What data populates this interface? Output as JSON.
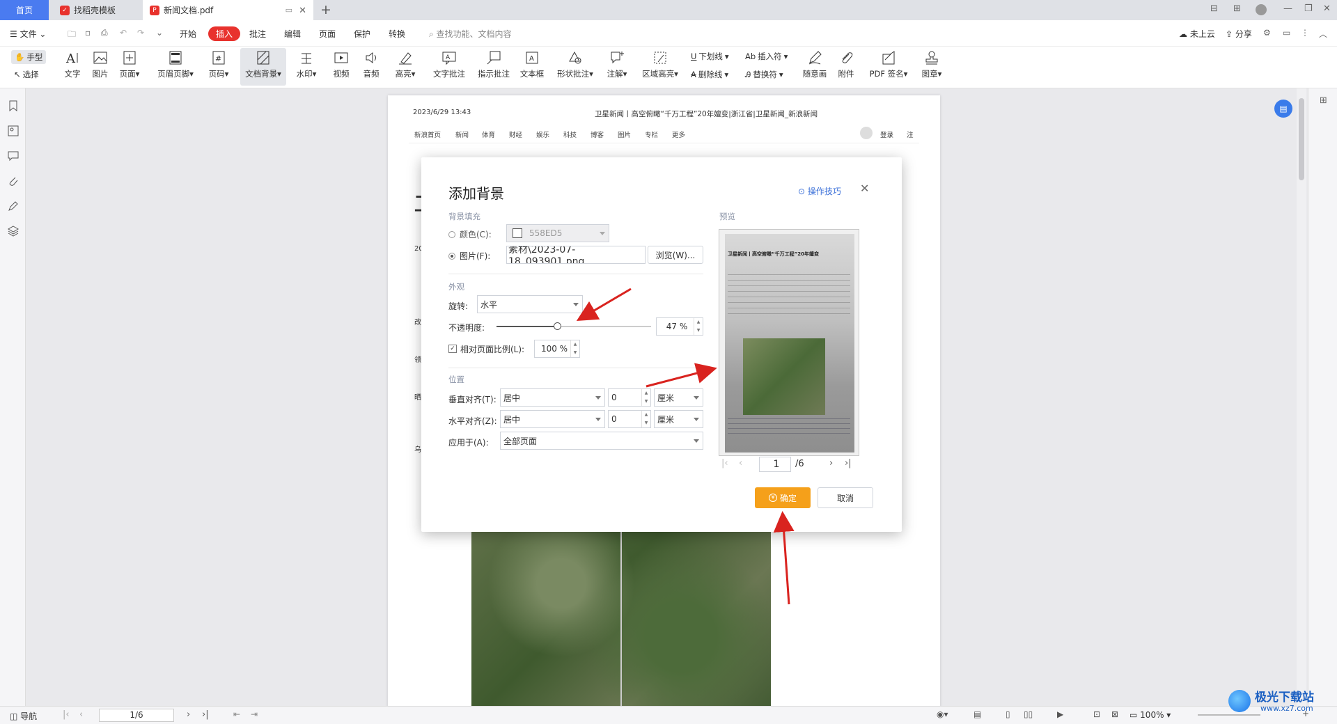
{
  "tabs": {
    "home": "首页",
    "tab1": "找稻壳模板",
    "tab2": "新闻文档.pdf"
  },
  "menu": {
    "file": "文件",
    "items": [
      "开始",
      "插入",
      "批注",
      "编辑",
      "页面",
      "保护",
      "转换"
    ],
    "active": "插入",
    "search": "查找功能、文档内容",
    "right": [
      "未上云",
      "分享"
    ]
  },
  "toolbar": {
    "hand": "手型",
    "select": "选择",
    "buttons": [
      "文字",
      "图片",
      "页面",
      "页眉页脚",
      "页码",
      "文档背景",
      "水印",
      "视频",
      "音频",
      "高亮",
      "文字批注",
      "指示批注",
      "文本框",
      "形状批注",
      "注解",
      "区域高亮"
    ],
    "underline": "下划线",
    "strikethrough": "删除线",
    "insert_symbol": "插入符",
    "replace_symbol": "替换符",
    "more": [
      "随意画",
      "附件",
      "PDF 签名",
      "图章"
    ]
  },
  "page": {
    "datetime": "2023/6/29 13:43",
    "header_title": "卫星新闻丨高空俯瞰“千万工程”20年嬗变|浙江省|卫星新闻_新浪新闻",
    "nav": [
      "新浪首页",
      "新闻",
      "体育",
      "财经",
      "娱乐",
      "科技",
      "博客",
      "图片",
      "专栏",
      "更多"
    ],
    "login": "登录",
    "register": "注",
    "left_fragments": [
      "卫",
      "20",
      "改",
      "领",
      "晒",
      "乌"
    ]
  },
  "dialog": {
    "title": "添加背景",
    "tips": "操作技巧",
    "section_fill": "背景填充",
    "color_label": "颜色(C):",
    "color_value": "558ED5",
    "image_label": "图片(F):",
    "image_path": "素材\\2023-07-18_093901.png",
    "browse": "浏览(W)...",
    "section_look": "外观",
    "rotate_label": "旋转:",
    "rotate_value": "水平",
    "opacity_label": "不透明度:",
    "opacity_value": "47 %",
    "opacity_fraction": 0.47,
    "scale_label": "相对页面比例(L):",
    "scale_value": "100 %",
    "section_position": "位置",
    "valign_label": "垂直对齐(T):",
    "valign_value": "居中",
    "valign_offset": "0",
    "valign_unit": "厘米",
    "halign_label": "水平对齐(Z):",
    "halign_value": "居中",
    "halign_offset": "0",
    "halign_unit": "厘米",
    "apply_label": "应用于(A):",
    "apply_value": "全部页面",
    "preview_label": "预览",
    "preview_page": "1",
    "preview_total": "/6",
    "preview_title": "卫星新闻丨高空俯瞰“千万工程”20年嬗变",
    "ok": "确定",
    "cancel": "取消"
  },
  "status": {
    "nav": "导航",
    "page": "1/6",
    "zoom": "100%"
  },
  "watermark": {
    "site": "极光下载站",
    "url": "www.xz7.com"
  },
  "colors": {
    "accent_red": "#e8322d",
    "primary_blue": "#4a7bf0",
    "ok_orange": "#f5a01a",
    "arrow_red": "#d9231f"
  }
}
